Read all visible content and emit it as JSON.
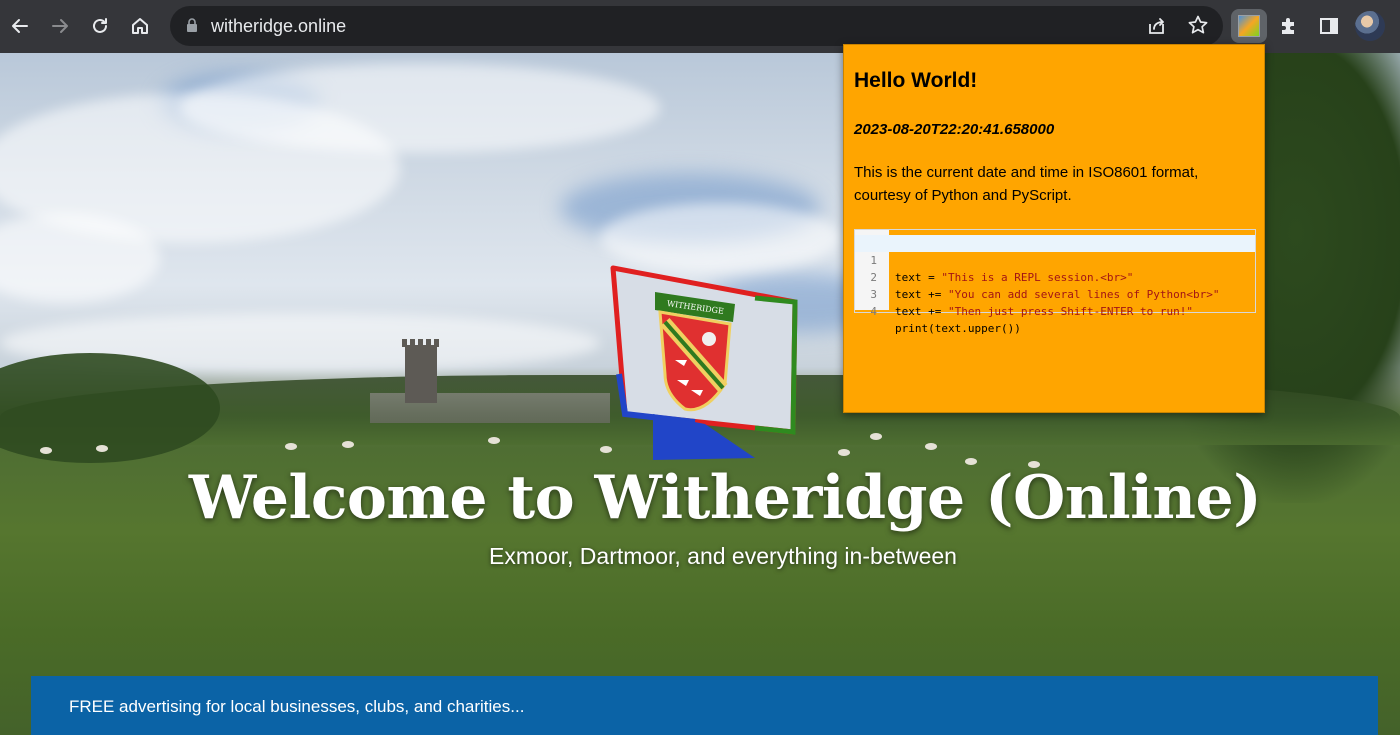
{
  "browser": {
    "url": "witheridge.online",
    "icons": {
      "back": "back-arrow-icon",
      "forward": "forward-arrow-icon",
      "reload": "reload-icon",
      "home": "home-icon",
      "lock": "lock-icon",
      "share": "share-icon",
      "bookmark": "star-icon",
      "extension_active": "pyscript-extension-icon",
      "extensions": "puzzle-icon",
      "side_panel": "side-panel-icon",
      "profile": "profile-avatar"
    }
  },
  "hero": {
    "title": "Welcome to Witheridge (Online)",
    "subtitle": "Exmoor, Dartmoor, and everything in-between",
    "logo_banner_text": "WITHERIDGE"
  },
  "banner": {
    "text": "FREE advertising for local businesses, clubs, and charities...",
    "color": "#0b63a6"
  },
  "popup": {
    "heading": "Hello World!",
    "timestamp": "2023-08-20T22:20:41.658000",
    "description": "This is the current date and time in ISO8601 format, courtesy of Python and PyScript.",
    "background": "#ffa500",
    "repl": {
      "lines": [
        {
          "num": "1",
          "before": "text = ",
          "string": "\"This is a REPL session.<br>\"",
          "after": ""
        },
        {
          "num": "2",
          "before": "text += ",
          "string": "\"You can add several lines of Python<br>\"",
          "after": ""
        },
        {
          "num": "3",
          "before": "text += ",
          "string": "\"Then just press Shift-ENTER to run!\"",
          "after": ""
        },
        {
          "num": "4",
          "before": "print(text.upper())",
          "string": "",
          "after": ""
        }
      ]
    }
  }
}
